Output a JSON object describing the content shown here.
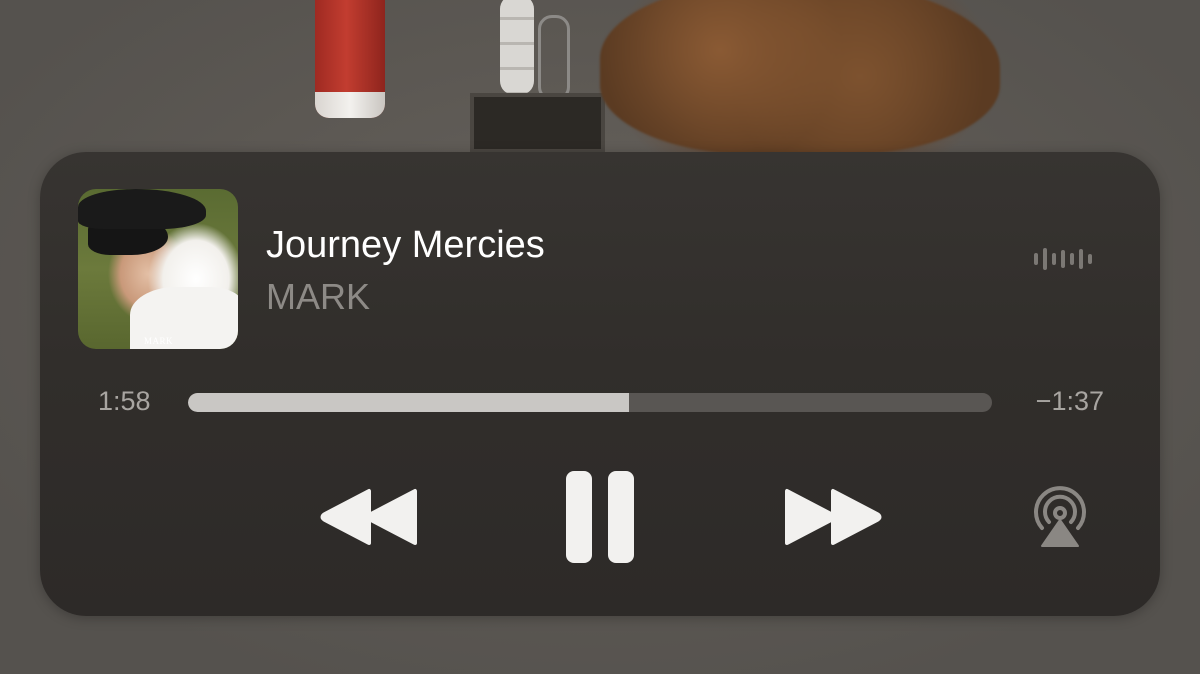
{
  "now_playing": {
    "title": "Journey Mercies",
    "artist": "MARK",
    "artwork_text": "MARK",
    "elapsed": "1:58",
    "remaining": "−1:37",
    "progress": 0.548
  },
  "icons": {
    "waveform": "audio-waveform-icon",
    "previous": "backward-icon",
    "pause": "pause-icon",
    "next": "forward-icon",
    "airplay": "airplay-icon"
  },
  "colors": {
    "card_background": "#322f2c",
    "title": "#ffffff",
    "artist": "#8d8a86",
    "progress_fill": "#c9c7c4",
    "progress_track": "#595653",
    "controls": "#f2f1ef"
  }
}
